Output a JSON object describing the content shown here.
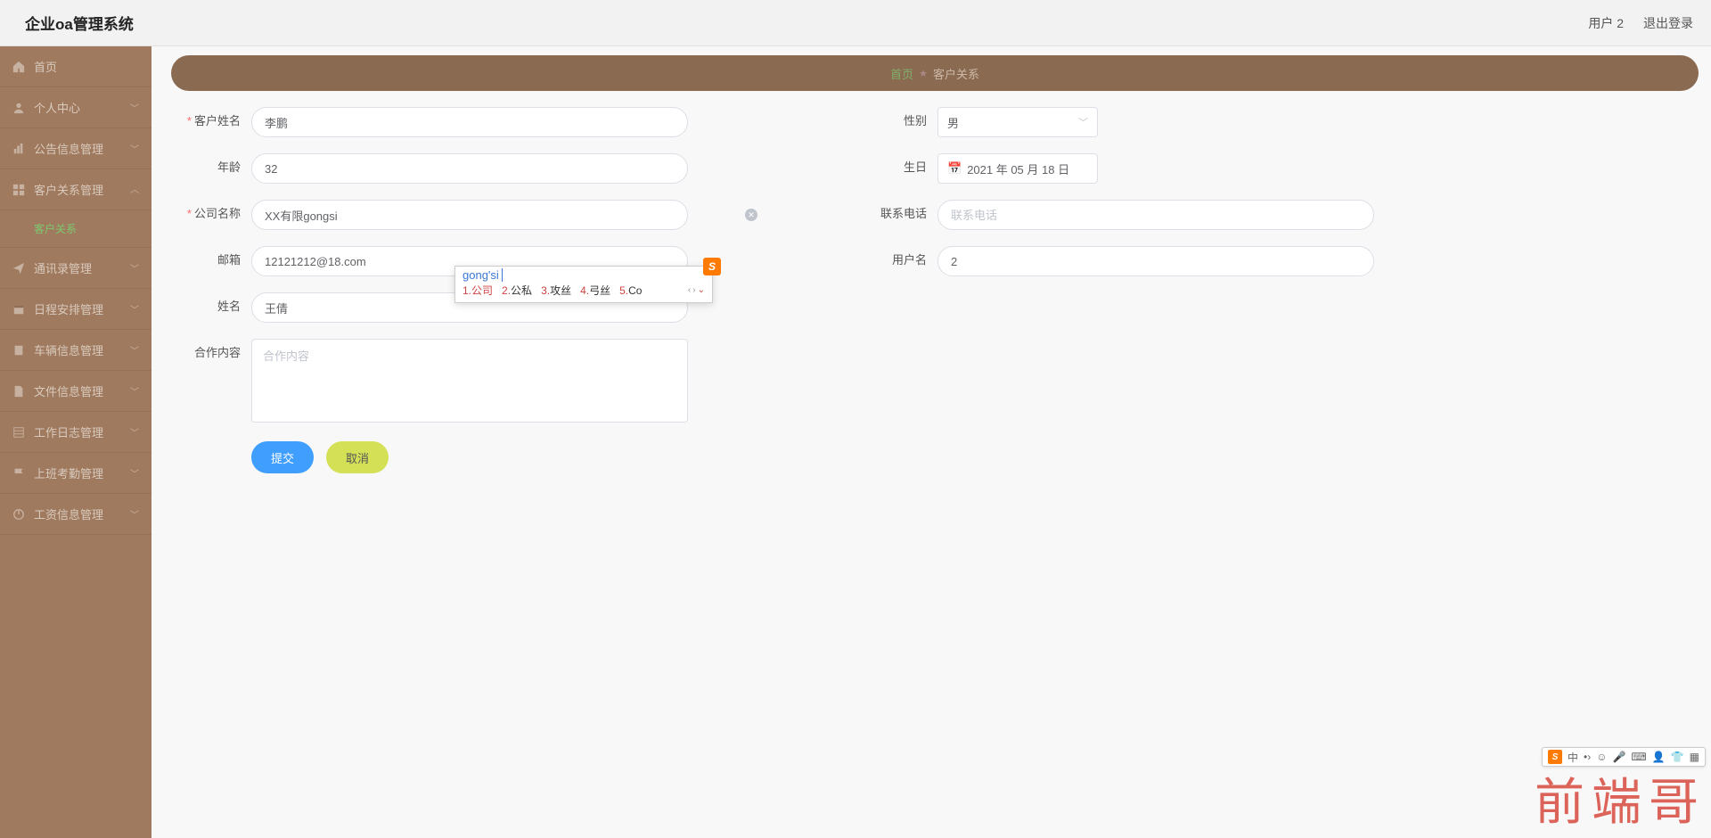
{
  "header": {
    "title": "企业oa管理系统",
    "user": "用户 2",
    "logout": "退出登录"
  },
  "sidebar": {
    "items": [
      {
        "label": "首页",
        "icon": "home"
      },
      {
        "label": "个人中心",
        "icon": "user"
      },
      {
        "label": "公告信息管理",
        "icon": "chart"
      },
      {
        "label": "客户关系管理",
        "icon": "grid",
        "expanded": true
      },
      {
        "label": "通讯录管理",
        "icon": "send"
      },
      {
        "label": "日程安排管理",
        "icon": "cal"
      },
      {
        "label": "车辆信息管理",
        "icon": "car"
      },
      {
        "label": "文件信息管理",
        "icon": "file"
      },
      {
        "label": "工作日志管理",
        "icon": "log"
      },
      {
        "label": "上班考勤管理",
        "icon": "flag"
      },
      {
        "label": "工资信息管理",
        "icon": "power"
      }
    ],
    "sub_customer": "客户关系"
  },
  "breadcrumb": {
    "home": "首页",
    "current": "客户关系"
  },
  "form": {
    "labels": {
      "customer_name": "客户姓名",
      "gender": "性别",
      "age": "年龄",
      "birthday": "生日",
      "company": "公司名称",
      "phone": "联系电话",
      "email": "邮箱",
      "username": "用户名",
      "name": "姓名",
      "content": "合作内容"
    },
    "values": {
      "customer_name": "李鹏",
      "gender": "男",
      "age": "32",
      "birthday": "2021 年 05 月 18 日",
      "company": "XX有限gongsi",
      "phone": "",
      "email": "12121212@18.com",
      "username": "2",
      "name": "王倩",
      "content": ""
    },
    "placeholders": {
      "phone": "联系电话",
      "content": "合作内容"
    },
    "buttons": {
      "submit": "提交",
      "cancel": "取消"
    }
  },
  "ime": {
    "input": "gong'si",
    "candidates": [
      {
        "n": "1.",
        "t": "公司"
      },
      {
        "n": "2.",
        "t": "公私"
      },
      {
        "n": "3.",
        "t": "攻丝"
      },
      {
        "n": "4.",
        "t": "弓丝"
      },
      {
        "n": "5.",
        "t": "Co"
      }
    ],
    "bar": "中"
  },
  "watermark": "前端哥"
}
